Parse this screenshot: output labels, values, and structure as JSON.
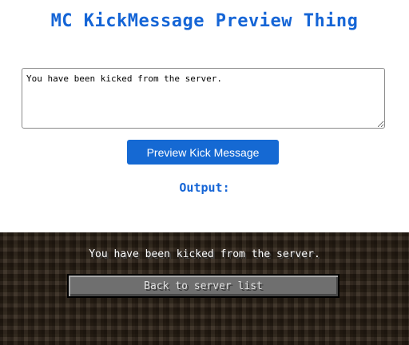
{
  "page": {
    "title": "MC KickMessage Preview Thing"
  },
  "editor": {
    "message_value": "You have been kicked from the server."
  },
  "actions": {
    "preview_label": "Preview Kick Message"
  },
  "output": {
    "label": "Output:"
  },
  "kick_screen": {
    "message": "You have been kicked from the server.",
    "back_button_label": "Back to server list"
  },
  "colors": {
    "accent": "#1565d6",
    "button": "#1569d3",
    "dirt_background": "#2f2418",
    "mc_button": "#6f6f6f"
  }
}
